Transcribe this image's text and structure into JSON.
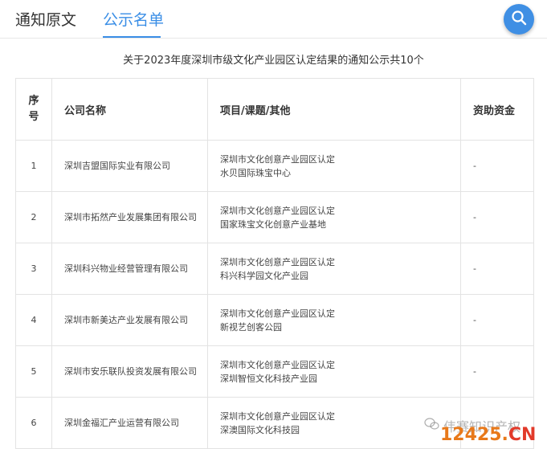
{
  "tabs": {
    "original": "通知原文",
    "list": "公示名单"
  },
  "search": {
    "icon": "search-icon",
    "button_color": "#3f8fe4"
  },
  "notice_title": "关于2023年度深圳市级文化产业园区认定结果的通知公示共10个",
  "table": {
    "headers": {
      "index": "序号",
      "company": "公司名称",
      "project": "项目/课题/其他",
      "funding": "资助资金"
    },
    "rows": [
      {
        "index": "1",
        "company": "深圳吉盟国际实业有限公司",
        "project_line1": "深圳市文化创意产业园区认定",
        "project_line2": "水贝国际珠宝中心",
        "funding": "-"
      },
      {
        "index": "2",
        "company": "深圳市拓然产业发展集团有限公司",
        "project_line1": "深圳市文化创意产业园区认定",
        "project_line2": "国家珠宝文化创意产业基地",
        "funding": "-"
      },
      {
        "index": "3",
        "company": "深圳科兴物业经营管理有限公司",
        "project_line1": "深圳市文化创意产业园区认定",
        "project_line2": "科兴科学园文化产业园",
        "funding": "-"
      },
      {
        "index": "4",
        "company": "深圳市新美达产业发展有限公司",
        "project_line1": "深圳市文化创意产业园区认定",
        "project_line2": "新视艺创客公园",
        "funding": "-"
      },
      {
        "index": "5",
        "company": "深圳市安乐联队投资发展有限公司",
        "project_line1": "深圳市文化创意产业园区认定",
        "project_line2": "深圳智恒文化科技产业园",
        "funding": "-"
      },
      {
        "index": "6",
        "company": "深圳金福汇产业运营有限公司",
        "project_line1": "深圳市文化创意产业园区认定",
        "project_line2": "深澳国际文化科技园",
        "funding": ""
      }
    ]
  },
  "watermark": {
    "text": "伟赛知识产权"
  },
  "site_mark": {
    "digits": "12425",
    "dot": ".",
    "cn": "CN"
  }
}
